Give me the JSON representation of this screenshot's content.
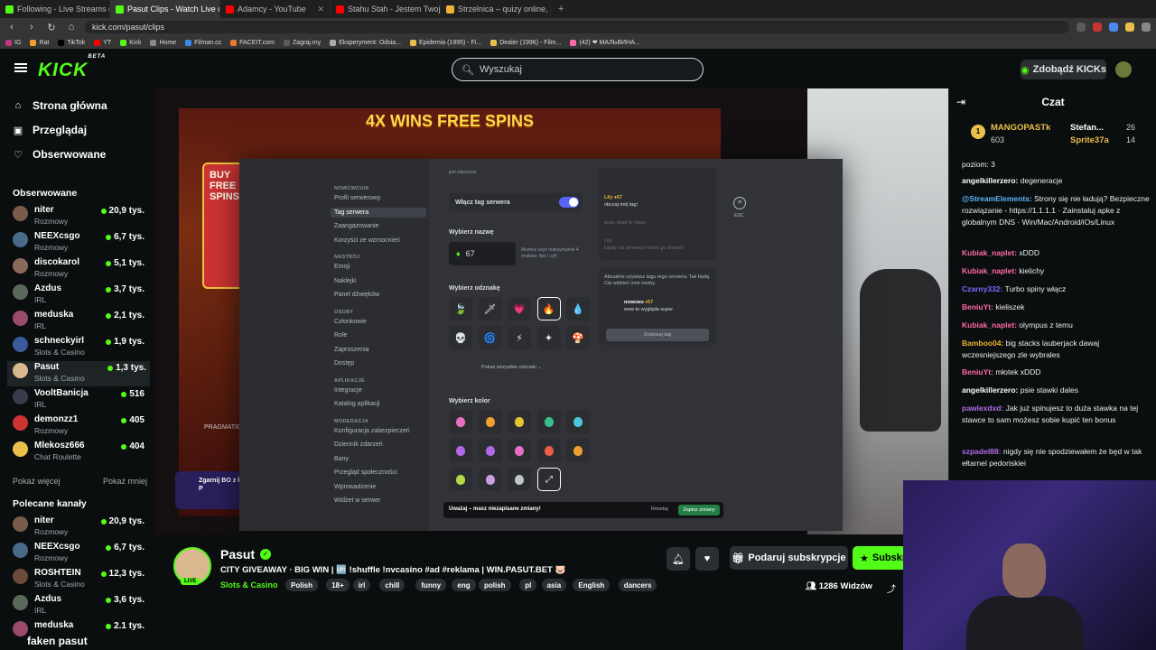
{
  "browser": {
    "tabs": [
      {
        "label": "Following - Live Streams on Kick",
        "color": "#53fc18",
        "active": false
      },
      {
        "label": "Pasut Clips - Watch Live on K",
        "color": "#53fc18",
        "active": true
      },
      {
        "label": "Adamcy - YouTube",
        "color": "#ff0000",
        "active": false
      },
      {
        "label": "Stahu Stah - Jestem Twoja Kokaina",
        "color": "#ff0000",
        "active": false
      },
      {
        "label": "Strzelnica – quizy online, szybka gra",
        "color": "#f0b232",
        "active": false
      }
    ],
    "url": "kick.com/pasut/clips",
    "bookmarks": [
      "IG",
      "Rat",
      "TikTok",
      "YT",
      "Kick",
      "Home",
      "Filman.cc",
      "FACEIT.com",
      "Zagraj.my",
      "Eksperyment: Odsia...",
      "Epidemia (1995) - Fi...",
      "Dealer (1996) - Film...",
      "(42) ❤ МАЛЬВИНА..."
    ]
  },
  "header": {
    "logo": "KICK",
    "logo_sup": "BETA",
    "search_placeholder": "Wyszukaj",
    "get_kicks": "Zdobądź KICKs"
  },
  "sidebar": {
    "nav": [
      {
        "label": "Strona główna",
        "icon": "⌂"
      },
      {
        "label": "Przeglądaj",
        "icon": "▣"
      },
      {
        "label": "Obserwowane",
        "icon": "♡"
      }
    ],
    "followed_title": "Obserwowane",
    "followed": [
      {
        "name": "niter",
        "category": "Rozmowy",
        "viewers": "20,9 tys.",
        "color": "#7a5b4a"
      },
      {
        "name": "NEEXcsgo",
        "category": "Rozmowy",
        "viewers": "6,7 tys.",
        "color": "#4a6a8a"
      },
      {
        "name": "discokarol",
        "category": "Rozmowy",
        "viewers": "5,1 tys.",
        "color": "#8a6a5a"
      },
      {
        "name": "Azdus",
        "category": "IRL",
        "viewers": "3,7 tys.",
        "color": "#5a6a5a"
      },
      {
        "name": "meduska",
        "category": "IRL",
        "viewers": "2,1 tys.",
        "color": "#9a4a6a"
      },
      {
        "name": "schneckyirl",
        "category": "Slots & Casino",
        "viewers": "1,9 tys.",
        "color": "#3a5a9a"
      },
      {
        "name": "Pasut",
        "category": "Slots & Casino",
        "viewers": "1,3 tys.",
        "color": "#d9b88f"
      },
      {
        "name": "VooltBanicja",
        "category": "IRL",
        "viewers": "516",
        "color": "#3a3a4a"
      },
      {
        "name": "demonzz1",
        "category": "Rozmowy",
        "viewers": "405",
        "color": "#c33"
      },
      {
        "name": "Mlekosz666",
        "category": "Chat Roulette",
        "viewers": "404",
        "color": "#e9c04a"
      }
    ],
    "show_more": "Pokaż więcej",
    "show_less": "Pokaż mniej",
    "recommended_title": "Polecane kanały",
    "recommended": [
      {
        "name": "niter",
        "category": "Rozmowy",
        "viewers": "20,9 tys.",
        "color": "#7a5b4a"
      },
      {
        "name": "NEEXcsgo",
        "category": "Rozmowy",
        "viewers": "6,7 tys.",
        "color": "#4a6a8a"
      },
      {
        "name": "ROSHTEIN",
        "category": "Slots & Casino",
        "viewers": "12,3 tys.",
        "color": "#6a4a3a"
      },
      {
        "name": "Azdus",
        "category": "IRL",
        "viewers": "3,6 tys.",
        "color": "#5a6a5a"
      },
      {
        "name": "meduska",
        "category": "",
        "viewers": "2.1 tys.",
        "color": "#9a4a6a"
      }
    ]
  },
  "stream": {
    "slot_title": "4X WINS FREE SPINS",
    "slot_left": "BUY FREE SPINS",
    "pragmatic": "PRAGMATIC PLAY",
    "promo": "Zgarnij BO z kodem P",
    "modal": {
      "nav": [
        {
          "type": "cat",
          "label": "NOWCWCUIA"
        },
        {
          "type": "item",
          "label": "Profil serwerowy"
        },
        {
          "type": "item",
          "label": "Tag serwera",
          "selected": true
        },
        {
          "type": "item",
          "label": "Zaangażowanie"
        },
        {
          "type": "item",
          "label": "Korzyści ze wzmocnień"
        },
        {
          "type": "cat",
          "label": "NASTRÓJ"
        },
        {
          "type": "item",
          "label": "Emoji"
        },
        {
          "type": "item",
          "label": "Naklejki"
        },
        {
          "type": "item",
          "label": "Panel dźwięków"
        },
        {
          "type": "cat",
          "label": "OSOBY"
        },
        {
          "type": "item",
          "label": "Członkowie"
        },
        {
          "type": "item",
          "label": "Role"
        },
        {
          "type": "item",
          "label": "Zaproszenia"
        },
        {
          "type": "item",
          "label": "Dostęp"
        },
        {
          "type": "cat",
          "label": "APLIKACJE"
        },
        {
          "type": "item",
          "label": "Integracje"
        },
        {
          "type": "item",
          "label": "Katalog aplikacji"
        },
        {
          "type": "cat",
          "label": "MODERACJA"
        },
        {
          "type": "item",
          "label": "Konfiguracja zabezpieczeń"
        },
        {
          "type": "item",
          "label": "Dziennik zdarzeń"
        },
        {
          "type": "item",
          "label": "Bany"
        },
        {
          "type": "item",
          "label": "Przegląd społeczności"
        },
        {
          "type": "item",
          "label": "Wprowadzenie"
        },
        {
          "type": "item",
          "label": "Widżet w serwer"
        }
      ],
      "intro_tail": "jest włączona.",
      "enable_tag": "Włącz tag serwera",
      "choose_name": "Wybierz nazwę",
      "name_value": "67",
      "name_hint": "Możesz użyć maksymalnie 4 znaków: liter i cyfr.",
      "choose_badge": "Wybierz odznakę",
      "badges": [
        "🍃",
        "🗡",
        "💗",
        "🔥",
        "💧",
        "💀",
        "🌀",
        "⚡",
        "✦",
        "🍄"
      ],
      "show_all_badges": "Pokaż wszystkie odznaki ⌄",
      "choose_color": "Wybierz kolor",
      "colors": [
        "#e86fc5",
        "#f0a030",
        "#e8c330",
        "#3bbf8a",
        "#4ac7d9",
        "#b06ae8",
        "#b06ae8",
        "#e86fc5",
        "#e8604a",
        "#f0a030",
        "#b5d94a",
        "#c8a0e0",
        "#c0c4c8"
      ],
      "warning": "Uważaj – masz niezapisane zmiany!",
      "reset": "Resetuj",
      "save": "Zapisz zmiany",
      "preview": {
        "lines": [
          "Lily",
          "obczaj mój tag!",
          "wow, skąd to masz",
          "Lily",
          "każdy na serwerze może go dostać!"
        ],
        "adopt_info": "Aktualnie używasz tagu tego serwera. Tak będą Cię widzieć inne osoby.",
        "sample_user": "nowcwu",
        "sample_tag": "67",
        "sample_msg": "wow to wygląda super",
        "adopt_btn": "Zostosuj tag"
      },
      "esc": "ESC"
    }
  },
  "streamer": {
    "name": "Pasut",
    "live": "LIVE",
    "title": "CITY GIVEAWAY · BIG WIN | 🆙 !shuffle !nvcasino #ad #reklama | WIN.PASUT.BET 🐷",
    "category": "Slots & Casino",
    "tags": [
      "Polish",
      "18+",
      "irl",
      "chill",
      "funny",
      "eng",
      "polish",
      "pl",
      "asia",
      "English",
      "dancers"
    ],
    "gift_subs": "Podaruj subskrypcje",
    "subscribe": "Subskrybuj",
    "viewers": "1286 Widzów"
  },
  "chat": {
    "title": "Czat",
    "pinned": [
      {
        "name": "MANGOPASTk",
        "num": "603"
      },
      {
        "name": "Stefan...",
        "num": "26"
      },
      {
        "name": "Sprite37a",
        "num": "14"
      }
    ],
    "messages": [
      {
        "user": "",
        "color": "#ccc",
        "text": "poziom: 3"
      },
      {
        "user": "angelkillerzero:",
        "color": "#ffffff",
        "text": "degeneracje"
      },
      {
        "user": "@StreamElements:",
        "color": "#59b7ff",
        "text": "Strony się nie ładują? Bezpieczne rozwiązanie - https://1.1.1.1 · Zainstaluj apke z globalnym DNS · Win/Mac/Android/iOs/Linux"
      },
      {
        "user": "Kubiak_naplet:",
        "color": "#ff6aa8",
        "text": "xDDD"
      },
      {
        "user": "Kubiak_naplet:",
        "color": "#ff6aa8",
        "text": "kielichy"
      },
      {
        "user": "Czarny332:",
        "color": "#7a6aff",
        "text": "Turbo spiny włącz"
      },
      {
        "user": "BeniuYt:",
        "color": "#ff6aa8",
        "text": "kieliszek"
      },
      {
        "user": "Kubiak_naplet:",
        "color": "#ff6aa8",
        "text": "olympus z temu"
      },
      {
        "user": "Bamboo04:",
        "color": "#f0b232",
        "text": "big stacks lauberjack dawaj wczesniejszego zle wybrales"
      },
      {
        "user": "BeniuYt:",
        "color": "#ff6aa8",
        "text": "młotek xDDD"
      },
      {
        "user": "angelkillerzero:",
        "color": "#ffffff",
        "text": "psie stawki dales"
      },
      {
        "user": "pawlexdxd:",
        "color": "#b06ae8",
        "text": "Jak już spinujesz to duża stawka na tej stawce to sam możesz sobie kupić ten bonus"
      },
      {
        "user": "szpadel88:",
        "color": "#b06ae8",
        "text": "nigdy się nie spodziewałem że będ w tak ełtarnel pedoriskiei"
      }
    ],
    "cam_overlay": "faken pasut"
  }
}
